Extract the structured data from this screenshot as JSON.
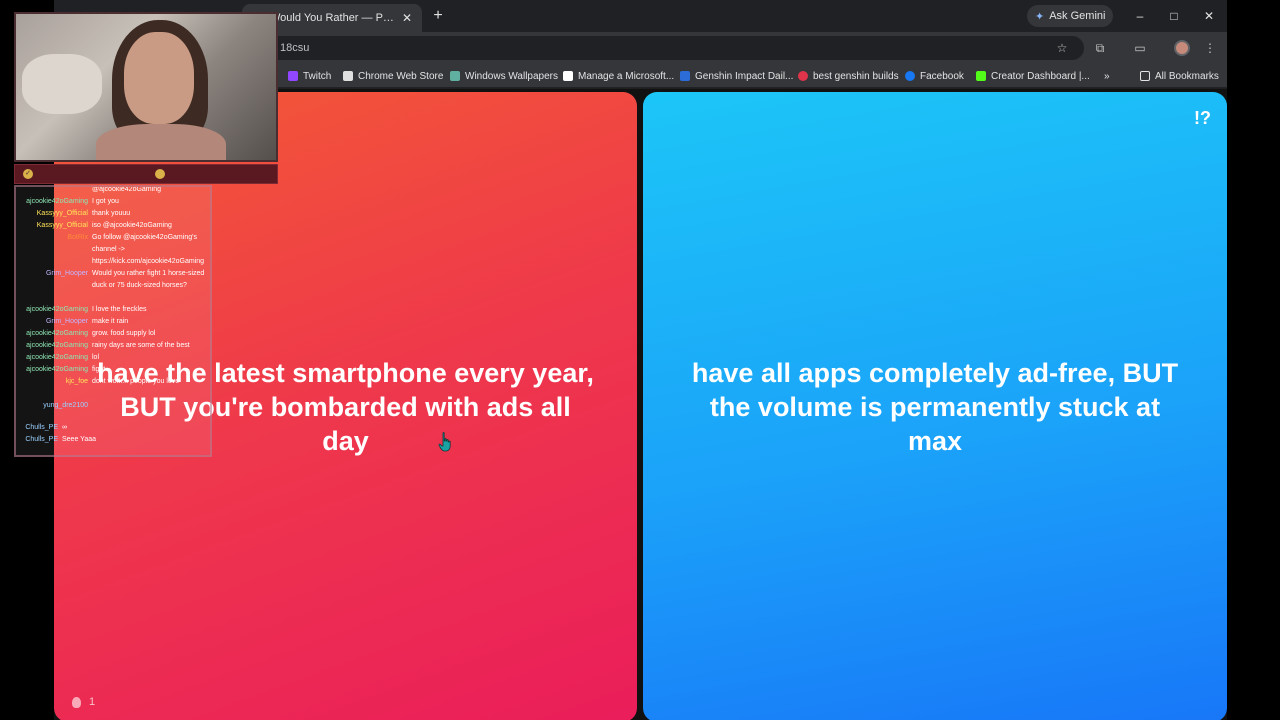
{
  "browser": {
    "tabs": [
      {
        "label": "",
        "active": false
      },
      {
        "label": "Would You Rather — Play the G",
        "active": true
      }
    ],
    "new_tab_label": "+",
    "gemini_label": "Ask Gemini",
    "window_controls": {
      "minimize": "–",
      "maximize": "□",
      "close": "✕"
    },
    "address": "18csu",
    "bookmarks": [
      {
        "label": "Twitch",
        "icon": "twitch-icon",
        "color": "#9146ff"
      },
      {
        "label": "Chrome Web Store",
        "icon": "chrome-store-icon",
        "color": "#e0e0e0"
      },
      {
        "label": "Windows Wallpapers",
        "icon": "wallpaper-icon",
        "color": "#5fb0a0"
      },
      {
        "label": "Manage a Microsoft...",
        "icon": "microsoft-icon",
        "color": "#ffffff"
      },
      {
        "label": "Genshin Impact Dail...",
        "icon": "genshin-icon",
        "color": "#2b6cd8"
      },
      {
        "label": "best genshin builds",
        "icon": "genshin-builds-icon",
        "color": "#e0344a"
      },
      {
        "label": "Facebook",
        "icon": "facebook-icon",
        "color": "#1877f2"
      },
      {
        "label": "Creator Dashboard |...",
        "icon": "kick-icon",
        "color": "#53fc18"
      }
    ],
    "bookmarks_overflow": "»",
    "all_bookmarks_label": "All Bookmarks"
  },
  "game": {
    "option_a": "have the latest smartphone every year, BUT you're bombarded with ads all day",
    "option_b": "have all apps completely ad-free, BUT the volume is permanently stuck at max",
    "badge": "!?",
    "likes_count": "1",
    "colors": {
      "left": "#ef3a4a",
      "right": "#1ba2f9"
    }
  },
  "chat": {
    "lines": [
      {
        "user": "",
        "msg": "@ajcookie42oGaming",
        "ucolor": "c1"
      },
      {
        "user": "ajcookie42oGaming",
        "msg": "I got you",
        "ucolor": "c1"
      },
      {
        "user": "Kassyyy_Official",
        "msg": "thank youuu",
        "ucolor": "c2"
      },
      {
        "user": "Kassyyy_Official",
        "msg": "iso @ajcookie42oGaming",
        "ucolor": "c2"
      },
      {
        "user": "BotRix",
        "msg": "Go follow @ajcookie42oGaming's channel -> https://kick.com/ajcookie42oGaming",
        "ucolor": "c3"
      },
      {
        "user": "Grim_Hooper",
        "msg": "Would you rather fight 1 horse-sized duck or 75 duck-sized horses?",
        "ucolor": "c4"
      },
      {
        "user": "ajcookie42oGaming",
        "msg": "I love the freckles",
        "ucolor": "c1"
      },
      {
        "user": "Grim_Hooper",
        "msg": "make it rain",
        "ucolor": "c4"
      },
      {
        "user": "ajcookie42oGaming",
        "msg": "grow. food supply lol",
        "ucolor": "c1"
      },
      {
        "user": "ajcookie42oGaming",
        "msg": "rainy days are some of the best",
        "ucolor": "c1"
      },
      {
        "user": "ajcookie42oGaming",
        "msg": "lol",
        "ucolor": "c1"
      },
      {
        "user": "ajcookie42oGaming",
        "msg": "fight...",
        "ucolor": "c1"
      },
      {
        "user": "kjc_foe",
        "msg": "dont work... people you love",
        "ucolor": "c2"
      },
      {
        "user": "yung_dre2100",
        "msg": "",
        "ucolor": "c5"
      },
      {
        "user": "Chulls_PE",
        "msg": "∞",
        "ucolor": "c5"
      },
      {
        "user": "Chulls_PE",
        "msg": "Seee Yaaa",
        "ucolor": "c5"
      }
    ]
  }
}
